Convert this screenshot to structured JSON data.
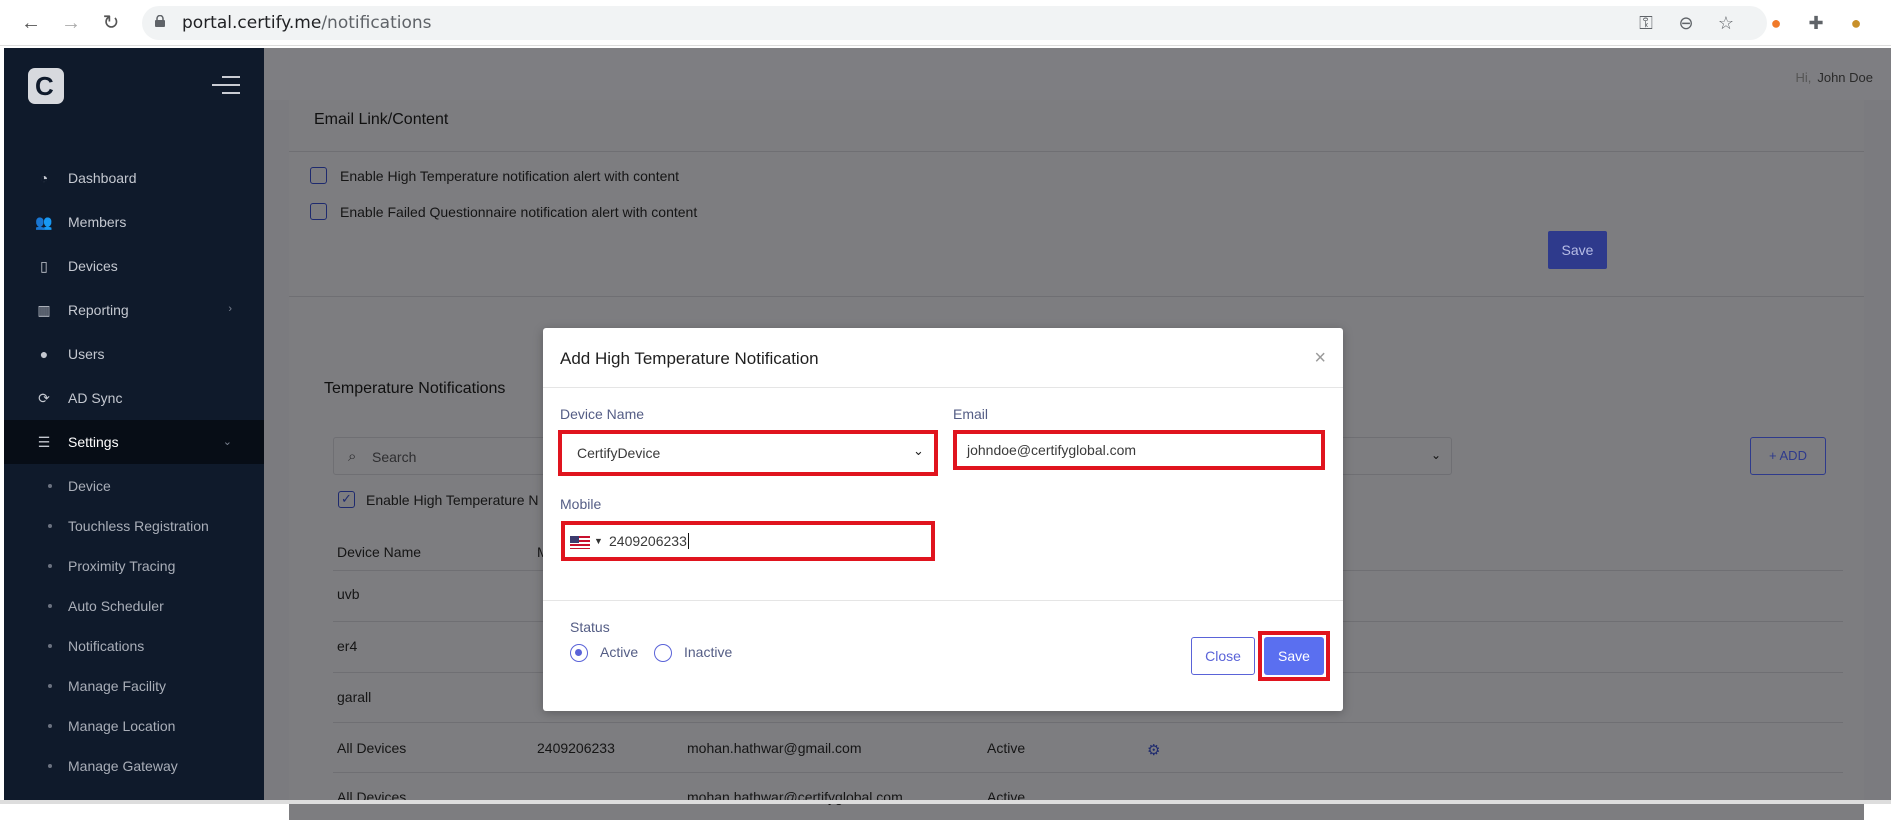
{
  "browser": {
    "url_host": "portal.certify.me",
    "url_path": "/notifications"
  },
  "header": {
    "greeting_prefix": "Hi,",
    "user_name": "John Doe"
  },
  "sidebar": {
    "logo_letter": "C",
    "items": [
      {
        "label": "Dashboard",
        "icon": "dashboard-icon"
      },
      {
        "label": "Members",
        "icon": "members-icon"
      },
      {
        "label": "Devices",
        "icon": "devices-icon"
      },
      {
        "label": "Reporting",
        "icon": "reporting-icon"
      },
      {
        "label": "Users",
        "icon": "user-icon"
      },
      {
        "label": "AD Sync",
        "icon": "sync-icon"
      },
      {
        "label": "Settings",
        "icon": "settings-icon"
      }
    ],
    "sub_items": [
      "Device",
      "Touchless Registration",
      "Proximity Tracing",
      "Auto Scheduler",
      "Notifications",
      "Manage Facility",
      "Manage Location",
      "Manage Gateway"
    ]
  },
  "email_section": {
    "title": "Email Link/Content",
    "checkbox_1": "Enable High Temperature notification alert with content",
    "checkbox_2": "Enable Failed Questionnaire notification alert with content",
    "save_label": "Save"
  },
  "temperature_section": {
    "title": "Temperature Notifications",
    "search_placeholder": "Search",
    "add_label": "ADD",
    "enable_label": "Enable High Temperature N",
    "columns": [
      "Device Name",
      "M"
    ],
    "rows": [
      {
        "device": "uvb",
        "mobile": "",
        "email": "",
        "status": ""
      },
      {
        "device": "er4",
        "mobile": "",
        "email": "",
        "status": ""
      },
      {
        "device": "garall",
        "mobile": "",
        "email": "",
        "status": ""
      },
      {
        "device": "All Devices",
        "mobile": "2409206233",
        "email": "mohan.hathwar@gmail.com",
        "status": "Active"
      },
      {
        "device": "All Devices",
        "mobile": "",
        "email": "mohan.hathwar@certifyglobal.com",
        "status": "Active"
      }
    ]
  },
  "modal": {
    "title": "Add High Temperature Notification",
    "device_name_label": "Device Name",
    "device_name_value": "CertifyDevice",
    "email_label": "Email",
    "email_value": "johndoe@certifyglobal.com",
    "mobile_label": "Mobile",
    "mobile_value": "2409206233",
    "status_label": "Status",
    "status_active": "Active",
    "status_inactive": "Inactive",
    "close_label": "Close",
    "save_label": "Save"
  },
  "colors": {
    "accent": "#5a6ff0",
    "highlight": "#e0141e",
    "sidebar_bg": "#0f1a2b"
  }
}
